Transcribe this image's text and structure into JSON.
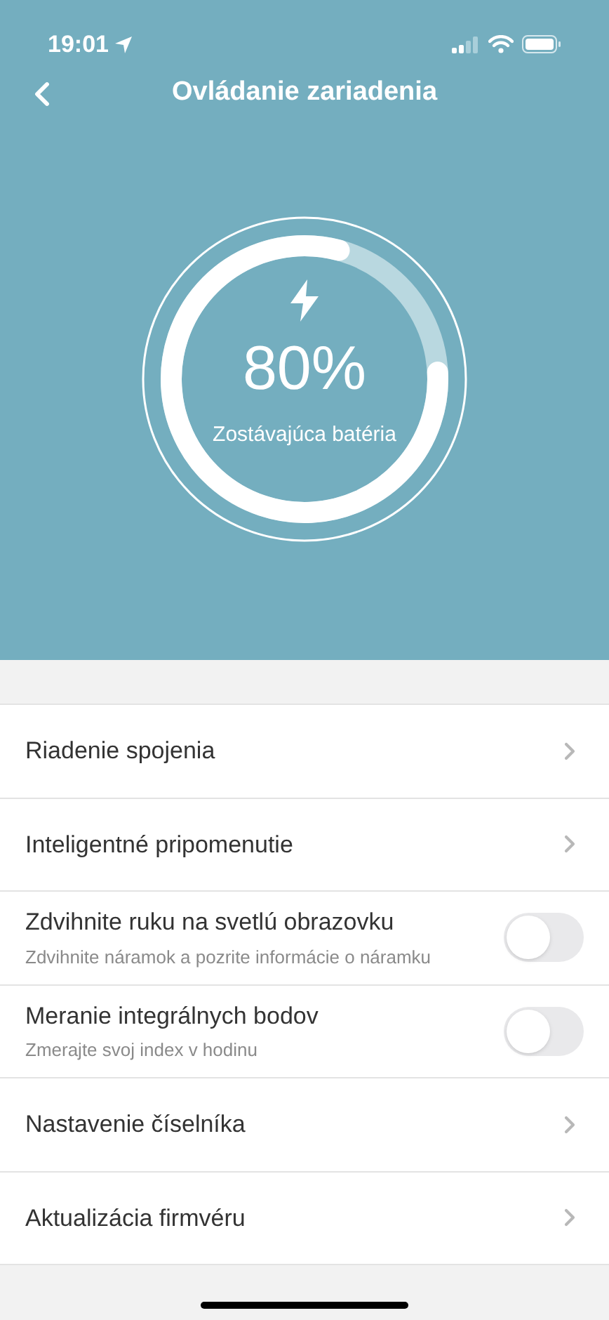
{
  "status_bar": {
    "time": "19:01"
  },
  "nav": {
    "title": "Ovládanie zariadenia"
  },
  "battery": {
    "percent": "80%",
    "label": "Zostávajúca batéria"
  },
  "settings": [
    {
      "kind": "link",
      "title": "Riadenie spojenia"
    },
    {
      "kind": "link",
      "title": "Inteligentné pripomenutie"
    },
    {
      "kind": "toggle",
      "title": "Zdvihnite ruku na svetlú obrazovku",
      "subtitle": "Zdvihnite náramok a pozrite informácie o náramku",
      "on": false
    },
    {
      "kind": "toggle",
      "title": "Meranie integrálnych bodov",
      "subtitle": "Zmerajte svoj index v hodinu",
      "on": false
    },
    {
      "kind": "link",
      "title": "Nastavenie číselníka"
    },
    {
      "kind": "link",
      "title": "Aktualizácia firmvéru"
    }
  ]
}
